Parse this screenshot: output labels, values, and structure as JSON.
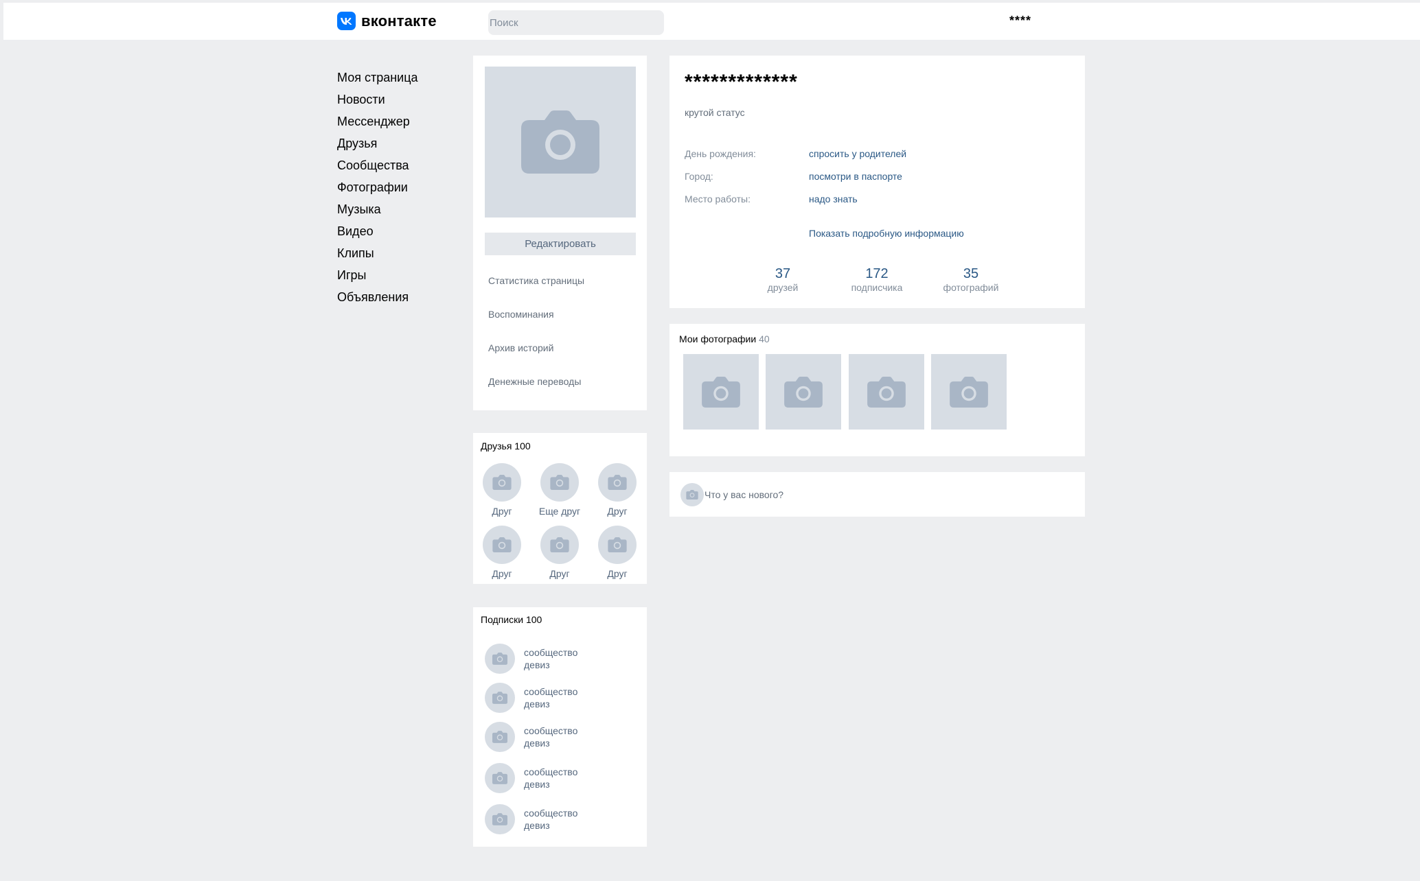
{
  "header": {
    "logo_text": "вконтакте",
    "search_placeholder": "Поиск",
    "user_name": "****"
  },
  "nav": {
    "items": [
      "Моя страница",
      "Новости",
      "Мессенджер",
      "Друзья",
      "Сообщества",
      "Фотографии",
      "Музыка",
      "Видео",
      "Клипы",
      "Игры",
      "Объявления"
    ]
  },
  "avatar_card": {
    "edit_label": "Редактировать",
    "links": [
      "Статистика страницы",
      "Воспоминания",
      "Архив историй",
      "Денежные переводы"
    ]
  },
  "friends": {
    "title": "Друзья 100",
    "items": [
      "Друг",
      "Еще друг",
      "Друг",
      "Друг",
      "Друг",
      "Друг"
    ]
  },
  "subscriptions": {
    "title": "Подписки 100",
    "items": [
      {
        "name": "сообщество",
        "motto": "девиз"
      },
      {
        "name": "сообщество",
        "motto": "девиз"
      },
      {
        "name": "сообщество",
        "motto": "девиз"
      },
      {
        "name": "сообщество",
        "motto": "девиз"
      },
      {
        "name": "сообщество",
        "motto": "девиз"
      }
    ]
  },
  "profile": {
    "name": "*************",
    "status": "крутой статус",
    "info": [
      {
        "label": "День рождения:",
        "value": "спросить у родителей"
      },
      {
        "label": "Город:",
        "value": "посмотри в паспорте"
      },
      {
        "label": "Место работы:",
        "value": "надо знать"
      }
    ],
    "show_more": "Показать подробную информацию",
    "counters": [
      {
        "value": "37",
        "label": "друзей"
      },
      {
        "value": "172",
        "label": "подписчика"
      },
      {
        "value": "35",
        "label": "фотографий"
      }
    ]
  },
  "photos": {
    "title": "Мои фотографии",
    "count": "40"
  },
  "new_post": {
    "placeholder": "Что у вас нового?"
  },
  "colors": {
    "background": "#edeef0",
    "brand": "#0077ff",
    "link": "#2a5885",
    "placeholder_fill": "#d7dde4",
    "camera_icon": "#a9b6c6"
  }
}
